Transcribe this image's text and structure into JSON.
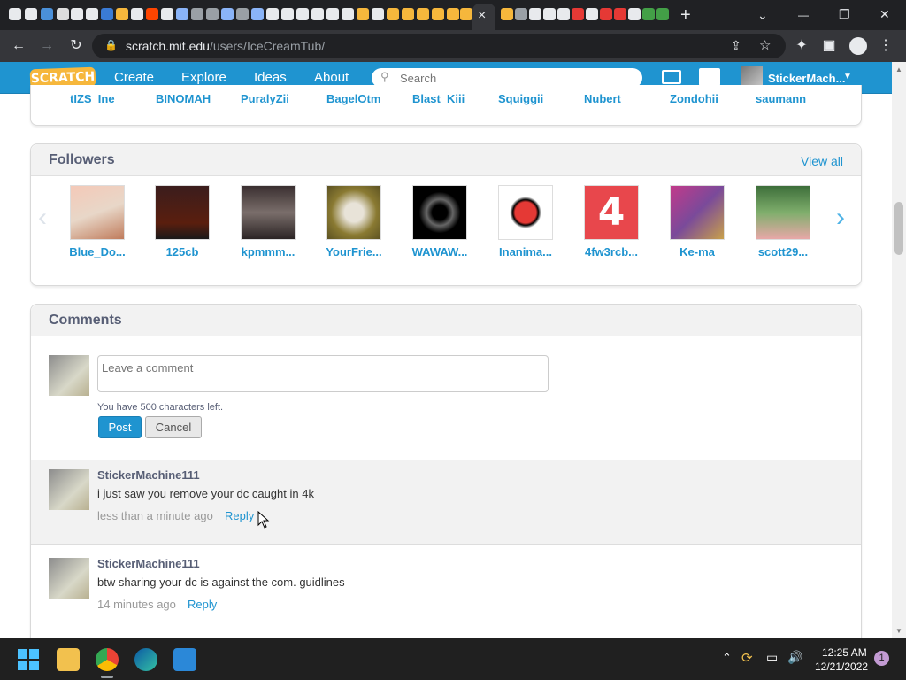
{
  "browser": {
    "active_tab_close": "×",
    "new_tab": "+",
    "window_minimize": "—",
    "window_maximize": "❐",
    "window_close": "✕",
    "url_host": "scratch.mit.edu",
    "url_path": "/users/IceCreamTub/"
  },
  "nav": {
    "logo": "SCRATCH",
    "create": "Create",
    "explore": "Explore",
    "ideas": "Ideas",
    "about": "About",
    "search_placeholder": "Search",
    "username": "StickerMach..."
  },
  "following_partial": [
    "tIZS_Ine",
    "BINOMAH",
    "PuralyZii",
    "BagelOtm",
    "Blast_Kiii",
    "Squiggii",
    "Nubert_",
    "Zondohii",
    "saumann"
  ],
  "followers": {
    "title": "Followers",
    "view_all": "View all",
    "users": [
      "Blue_Do...",
      "125cb",
      "kpmmm...",
      "YourFrie...",
      "WAWAW...",
      "Inanima...",
      "4fw3rcb...",
      "Ke-ma",
      "scott29..."
    ]
  },
  "comments": {
    "title": "Comments",
    "placeholder": "Leave a comment",
    "chars_left": "You have 500 characters left.",
    "post": "Post",
    "cancel": "Cancel",
    "items": [
      {
        "user": "StickerMachine111",
        "text": "i just saw you remove your dc caught in 4k",
        "time": "less than a minute ago",
        "reply": "Reply"
      },
      {
        "user": "StickerMachine111",
        "text": "btw sharing your dc is against the com. guidlines",
        "time": "14 minutes ago",
        "reply": "Reply"
      }
    ]
  },
  "taskbar": {
    "time": "12:25 AM",
    "date": "12/21/2022",
    "notif_count": "1"
  },
  "colors": {
    "scratch_blue": "#1f94d0",
    "text_gray": "#575e75"
  }
}
